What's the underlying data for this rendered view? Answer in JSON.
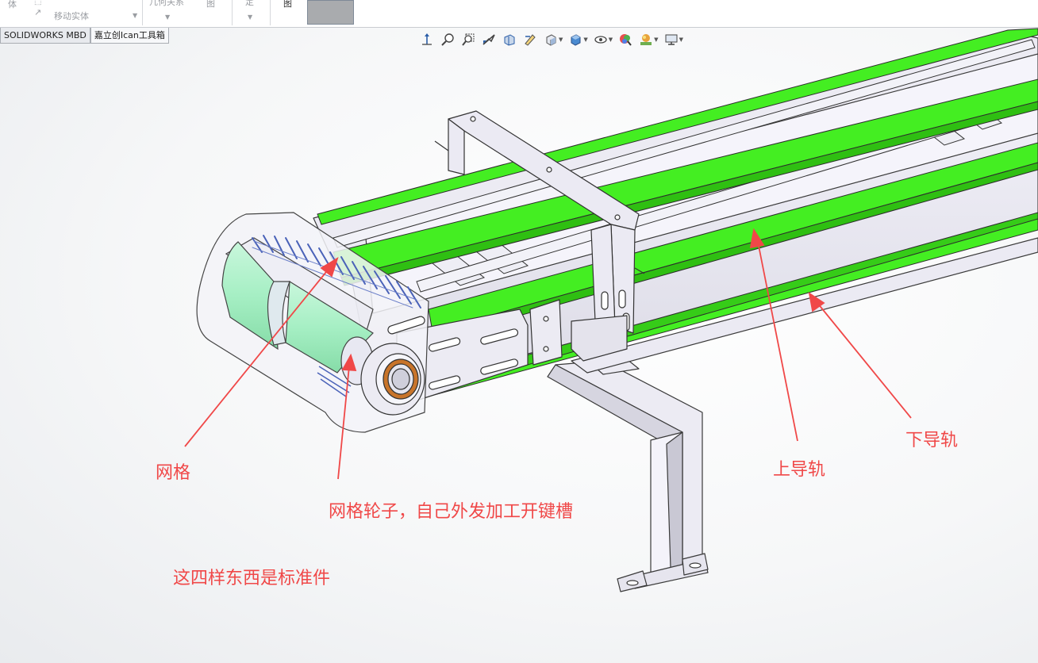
{
  "ribbon": {
    "item_body": "体",
    "item_move": "移动实体",
    "item_relations": "几何关系",
    "item_view": "图",
    "item_fix": "定",
    "item_sketch": "图"
  },
  "tabs": [
    {
      "label": "SOLIDWORKS MBD"
    },
    {
      "label": "嘉立创Ican工具箱"
    }
  ],
  "heads_up_toolbar": [
    "view-orientation-icon",
    "zoom-to-fit-icon",
    "zoom-area-icon",
    "previous-view-icon",
    "section-view-icon",
    "dynamic-annotation-icon",
    "view-orientation-cube-icon",
    "display-style-icon",
    "hide-show-items-icon",
    "edit-appearance-icon",
    "apply-scene-icon",
    "view-settings-icon"
  ],
  "annotations": {
    "mesh": "网格",
    "mesh_wheel": "网格轮子，自己外发加工开键槽",
    "standard_parts": "这四样东西是标准件",
    "upper_rail": "上导轨",
    "lower_rail": "下导轨"
  },
  "colors": {
    "rail_green": "#44ee22",
    "annotation_red": "#f04848",
    "roller_mint": "#a8f0c8",
    "bearing_orange": "#c8742a"
  }
}
